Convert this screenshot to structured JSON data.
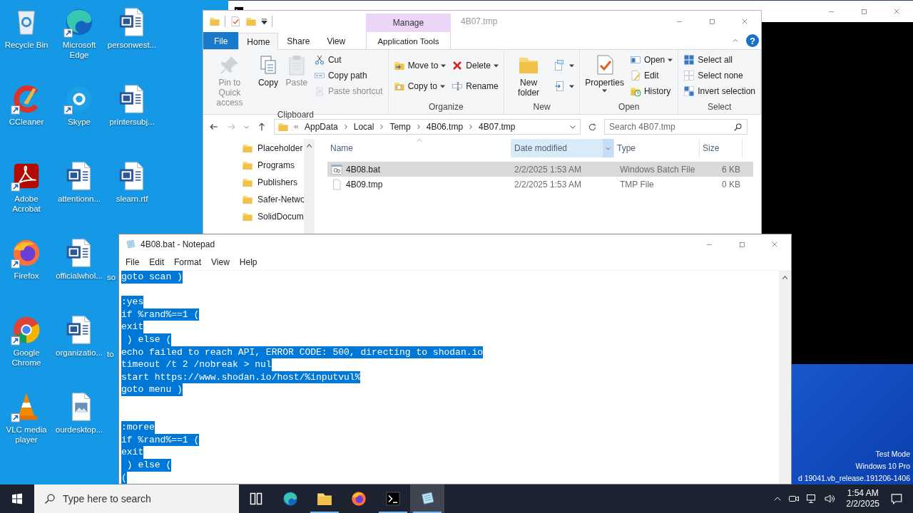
{
  "desktop": {
    "icons": [
      {
        "label": "Recycle Bin",
        "kind": "recycle",
        "shortcut": false
      },
      {
        "label": "CCleaner",
        "kind": "ccleaner",
        "shortcut": true
      },
      {
        "label": "Adobe Acrobat",
        "kind": "acrobat",
        "shortcut": true
      },
      {
        "label": "Firefox",
        "kind": "firefox",
        "shortcut": true
      },
      {
        "label": "Google Chrome",
        "kind": "chrome",
        "shortcut": true
      },
      {
        "label": "VLC media player",
        "kind": "vlc",
        "shortcut": true
      },
      {
        "label": "Microsoft Edge",
        "kind": "edge",
        "shortcut": true
      },
      {
        "label": "Skype",
        "kind": "skype",
        "shortcut": true
      },
      {
        "label": "attentionn...",
        "kind": "word",
        "shortcut": false
      },
      {
        "label": "officialwhol...",
        "kind": "word",
        "shortcut": false
      },
      {
        "label": "organizatio...",
        "kind": "word",
        "shortcut": false
      },
      {
        "label": "ourdesktop...",
        "kind": "image",
        "shortcut": false
      },
      {
        "label": "personwest...",
        "kind": "word",
        "shortcut": false
      },
      {
        "label": "printersubj...",
        "kind": "word",
        "shortcut": false
      },
      {
        "label": "slearn.rtf",
        "kind": "word",
        "shortcut": false
      }
    ],
    "covered_labels": [
      "so",
      "to"
    ],
    "os_info": [
      "Test Mode",
      "Windows 10 Pro",
      "d 19041.vb_release.191206-1406"
    ]
  },
  "explorer": {
    "title": "4B07.tmp",
    "context_group": "Manage",
    "help": "?",
    "tabs": [
      {
        "label": "File",
        "kind": "file",
        "selected": false
      },
      {
        "label": "Home",
        "kind": "tab",
        "selected": true
      },
      {
        "label": "Share",
        "kind": "tab",
        "selected": false
      },
      {
        "label": "View",
        "kind": "tab",
        "selected": false
      },
      {
        "label": "Application Tools",
        "kind": "context",
        "selected": false
      }
    ],
    "ribbon": [
      {
        "label": "Clipboard",
        "columns": [
          [
            {
              "label": "Pin to Quick access",
              "kind": "large",
              "disabled": true,
              "dropdown": false
            }
          ],
          [
            {
              "label": "Copy",
              "kind": "large",
              "disabled": false,
              "dropdown": false
            }
          ],
          [
            {
              "label": "Paste",
              "kind": "large",
              "disabled": true,
              "dropdown": false
            }
          ],
          [
            {
              "label": "Cut",
              "kind": "small",
              "disabled": false,
              "dropdown": false
            },
            {
              "label": "Copy path",
              "kind": "small",
              "disabled": false,
              "dropdown": false
            },
            {
              "label": "Paste shortcut",
              "kind": "small",
              "disabled": true,
              "dropdown": false
            }
          ]
        ]
      },
      {
        "label": "Organize",
        "columns": [
          [
            {
              "label": "Move to",
              "kind": "small",
              "disabled": false,
              "dropdown": true
            },
            {
              "label": "Copy to",
              "kind": "small",
              "disabled": false,
              "dropdown": true
            }
          ],
          [
            {
              "label": "Delete",
              "kind": "small",
              "disabled": false,
              "dropdown": true
            },
            {
              "label": "Rename",
              "kind": "small",
              "disabled": false,
              "dropdown": false
            }
          ]
        ]
      },
      {
        "label": "New",
        "columns": [
          [
            {
              "label": "New folder",
              "kind": "large",
              "disabled": false,
              "dropdown": false
            }
          ],
          [
            {
              "kind": "icon",
              "disabled": false,
              "dropdown": true
            },
            {
              "kind": "icon",
              "disabled": false,
              "dropdown": true
            }
          ]
        ]
      },
      {
        "label": "Open",
        "columns": [
          [
            {
              "label": "Properties",
              "kind": "large",
              "disabled": false,
              "dropdown": true
            }
          ],
          [
            {
              "label": "Open",
              "kind": "small",
              "disabled": false,
              "dropdown": true
            },
            {
              "label": "Edit",
              "kind": "small",
              "disabled": false,
              "dropdown": false
            },
            {
              "label": "History",
              "kind": "small",
              "disabled": false,
              "dropdown": false
            }
          ]
        ]
      },
      {
        "label": "Select",
        "columns": [
          [
            {
              "label": "Select all",
              "kind": "small",
              "disabled": false,
              "dropdown": false
            },
            {
              "label": "Select none",
              "kind": "small",
              "disabled": false,
              "dropdown": false
            },
            {
              "label": "Invert selection",
              "kind": "small",
              "disabled": false,
              "dropdown": false
            }
          ]
        ]
      }
    ],
    "crumbs": [
      "AppData",
      "Local",
      "Temp",
      "4B06.tmp",
      "4B07.tmp"
    ],
    "search": {
      "placeholder": "Search 4B07.tmp"
    },
    "nav": [
      "Placeholder",
      "Programs",
      "Publishers",
      "Safer-Netwo",
      "SolidDocum"
    ],
    "columns": [
      {
        "label": "Name",
        "sorted": true,
        "selected": false
      },
      {
        "label": "Date modified",
        "sorted": false,
        "selected": true
      },
      {
        "label": "Type",
        "sorted": false,
        "selected": false
      },
      {
        "label": "Size",
        "sorted": false,
        "selected": false
      }
    ],
    "rows": [
      {
        "name": "4B08.bat",
        "date": "2/2/2025 1:53 AM",
        "type": "Windows Batch File",
        "size": "6 KB",
        "kind": "batch",
        "selected": true
      },
      {
        "name": "4B09.tmp",
        "date": "2/2/2025 1:53 AM",
        "type": "TMP File",
        "size": "0 KB",
        "kind": "file",
        "selected": false
      }
    ]
  },
  "notepad": {
    "title": "4B08.bat - Notepad",
    "menu": [
      "File",
      "Edit",
      "Format",
      "View",
      "Help"
    ],
    "text_selected": true,
    "text": "goto scan )\n\n:yes\nif %rand%==1 (\nexit\n ) else (\necho failed to reach API, ERROR CODE: 500, directing to shodan.io\ntimeout /t 2 /nobreak > nul\nstart https://www.shodan.io/host/%inputvul%\ngoto menu )\n\n\n:moree\nif %rand%==1 (\nexit\n ) else (\n("
  },
  "taskbar": {
    "search": {
      "placeholder": "Type here to search"
    },
    "apps": [
      {
        "kind": "taskview",
        "running": false,
        "selected": false
      },
      {
        "kind": "edge",
        "running": false,
        "selected": false
      },
      {
        "kind": "explorer",
        "running": true,
        "selected": false
      },
      {
        "kind": "firefox",
        "running": false,
        "selected": false
      },
      {
        "kind": "terminal",
        "running": true,
        "selected": false
      },
      {
        "kind": "notepad",
        "running": true,
        "selected": true
      }
    ],
    "time": "1:54 AM",
    "date": "2/2/2025"
  }
}
